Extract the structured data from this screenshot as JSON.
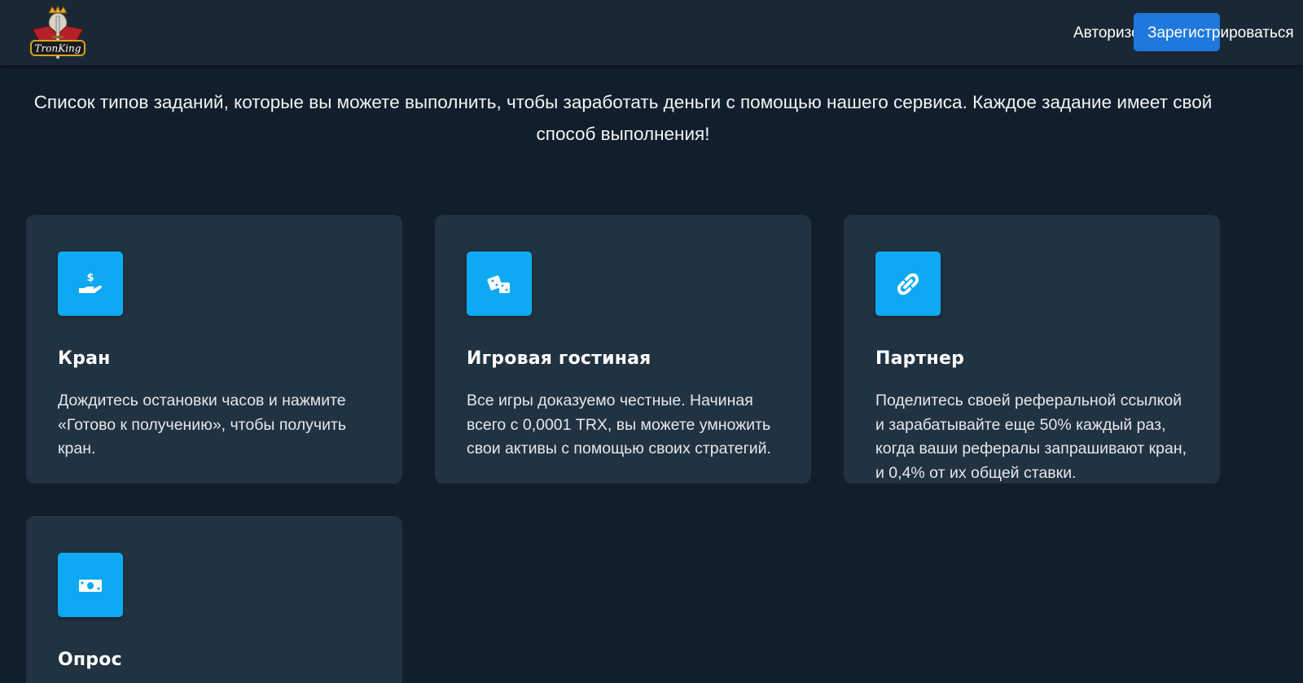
{
  "header": {
    "logo_text": "TronKing",
    "login_label": "Авторизоваться",
    "register_label": "Зарегистрироваться",
    "accent_color": "#1f78db"
  },
  "intro": {
    "text": "Список типов заданий, которые вы можете выполнить, чтобы заработать деньги с помощью нашего сервиса. Каждое задание имеет свой способ выполнения!"
  },
  "cards": [
    {
      "icon": "hand-dollar-icon",
      "title": "Кран",
      "description": "Дождитесь остановки часов и нажмите «Готово к получению», чтобы получить кран."
    },
    {
      "icon": "dice-icon",
      "title": "Игровая гостиная",
      "description": "Все игры доказуемо честные. Начиная всего с 0,0001 TRX, вы можете умножить свои активы с помощью своих стратегий."
    },
    {
      "icon": "link-icon",
      "title": "Партнер",
      "description": "Поделитесь своей реферальной ссылкой и зарабатывайте еще 50% каждый раз, когда ваши рефералы запрашивают кран, и 0,4% от их общей ставки."
    },
    {
      "icon": "money-bill-icon",
      "title": "Опрос",
      "description": ""
    }
  ],
  "colors": {
    "background": "#111f2c",
    "header": "#1a2835",
    "card": "#213240",
    "icon_box": "#0ea9f2"
  }
}
